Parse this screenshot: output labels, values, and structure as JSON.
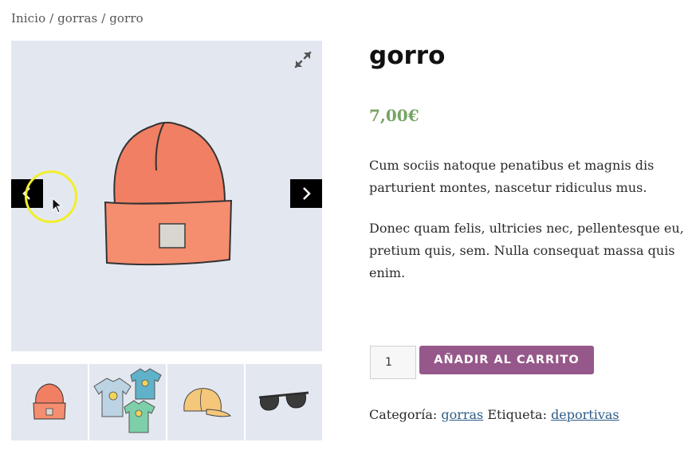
{
  "breadcrumb": {
    "home": "Inicio",
    "category": "gorras",
    "current": "gorro",
    "separator": " / "
  },
  "gallery": {
    "zoom_icon": "expand-icon",
    "prev_icon": "chevron-left-icon",
    "next_icon": "chevron-right-icon",
    "thumbnails": [
      "beanie",
      "hoodies-and-tshirts",
      "cap",
      "sunglasses"
    ]
  },
  "product": {
    "title": "gorro",
    "price": "7,00€",
    "description_1": "Cum sociis natoque penatibus et magnis dis parturient montes, nascetur ridiculus mus.",
    "description_2": "Donec quam felis, ultricies nec, pellentesque eu, pretium quis, sem. Nulla consequat massa quis enim.",
    "quantity": "1",
    "add_to_cart": "AÑADIR AL CARRITO",
    "category_label": "Categoría:",
    "category_link": "gorras",
    "tag_label": "Etiqueta:",
    "tag_link": "deportivas"
  },
  "colors": {
    "accent": "#96588a",
    "price": "#77a464",
    "link": "#2d5c88",
    "gallery_bg": "#e3e8f0",
    "hat": "#f07f64"
  }
}
